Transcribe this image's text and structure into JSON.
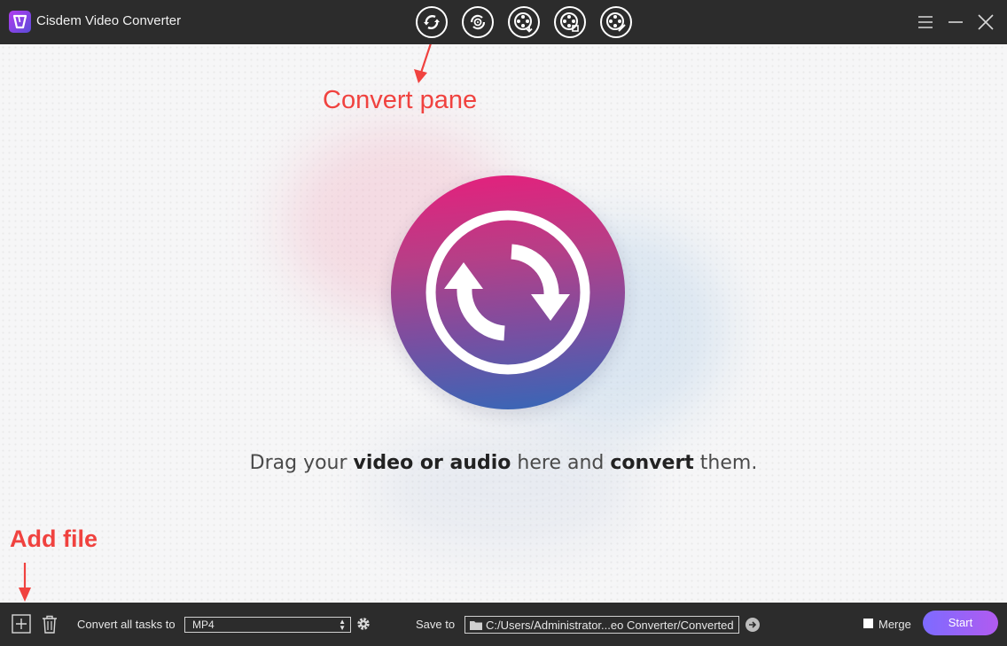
{
  "window": {
    "title": "Cisdem Video Converter",
    "mode_buttons": [
      "convert-mode-icon",
      "rip-dvd-icon",
      "download-icon",
      "compress-icon",
      "edit-video-icon"
    ],
    "controls": [
      "menu-icon",
      "minimize-icon",
      "close-icon"
    ]
  },
  "annotations": {
    "convert_pane": "Convert pane",
    "add_file": "Add file"
  },
  "main": {
    "tagline": {
      "part1": "Drag your ",
      "bold1": "video or audio",
      "part2": " here and ",
      "bold2": "convert",
      "part3": " them."
    }
  },
  "bottom_bar": {
    "convert_all_label": "Convert all tasks to",
    "format_value": "MP4",
    "save_to_label": "Save to",
    "save_path": "C:/Users/Administrator...eo Converter/Converted",
    "merge_label": "Merge",
    "start_label": "Start"
  },
  "colors": {
    "bar_bg": "#2c2c2c",
    "annotation": "#f0423f",
    "start_gradient_from": "#7d6bff",
    "start_gradient_to": "#b15bf0"
  }
}
